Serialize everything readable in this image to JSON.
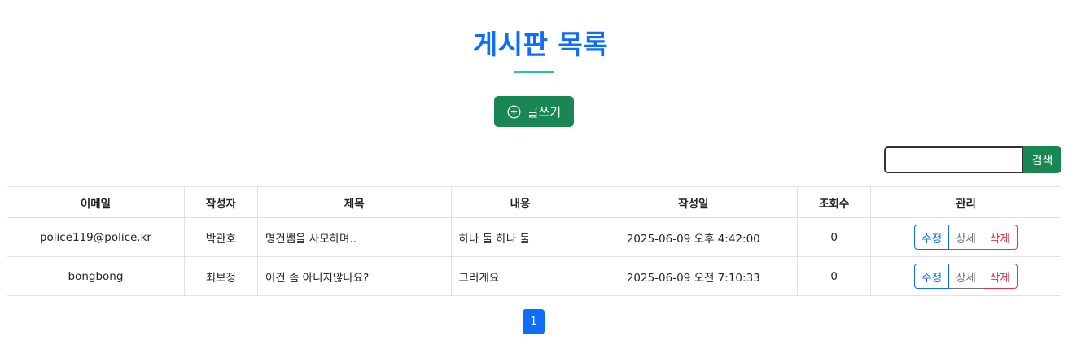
{
  "header": {
    "title": "게시판 목록",
    "write_button_label": "글쓰기",
    "write_icon": "plus-circle-icon"
  },
  "search": {
    "value": "",
    "button_label": "검색"
  },
  "table": {
    "columns": [
      "이메일",
      "작성자",
      "제목",
      "내용",
      "작성일",
      "조회수",
      "관리"
    ],
    "rows": [
      {
        "email": "police119@police.kr",
        "author": "박관호",
        "title": "명건쌤을 사모하며..",
        "content": "하나 둘 하나 둘",
        "date": "2025-06-09 오후 4:42:00",
        "views": "0",
        "edit": "수정",
        "detail": "상세",
        "delete": "삭제"
      },
      {
        "email": "bongbong",
        "author": "최보정",
        "title": "이건 좀 아니지않나요?",
        "content": "그러게요",
        "date": "2025-06-09 오전 7:10:33",
        "views": "0",
        "edit": "수정",
        "detail": "상세",
        "delete": "삭제"
      }
    ]
  },
  "pagination": {
    "current": "1"
  },
  "colors": {
    "title": "#0d6efd",
    "underline": "#20c997",
    "success": "#198754",
    "primary": "#0d6efd",
    "secondary": "#6c757d",
    "danger": "#dc3545"
  }
}
